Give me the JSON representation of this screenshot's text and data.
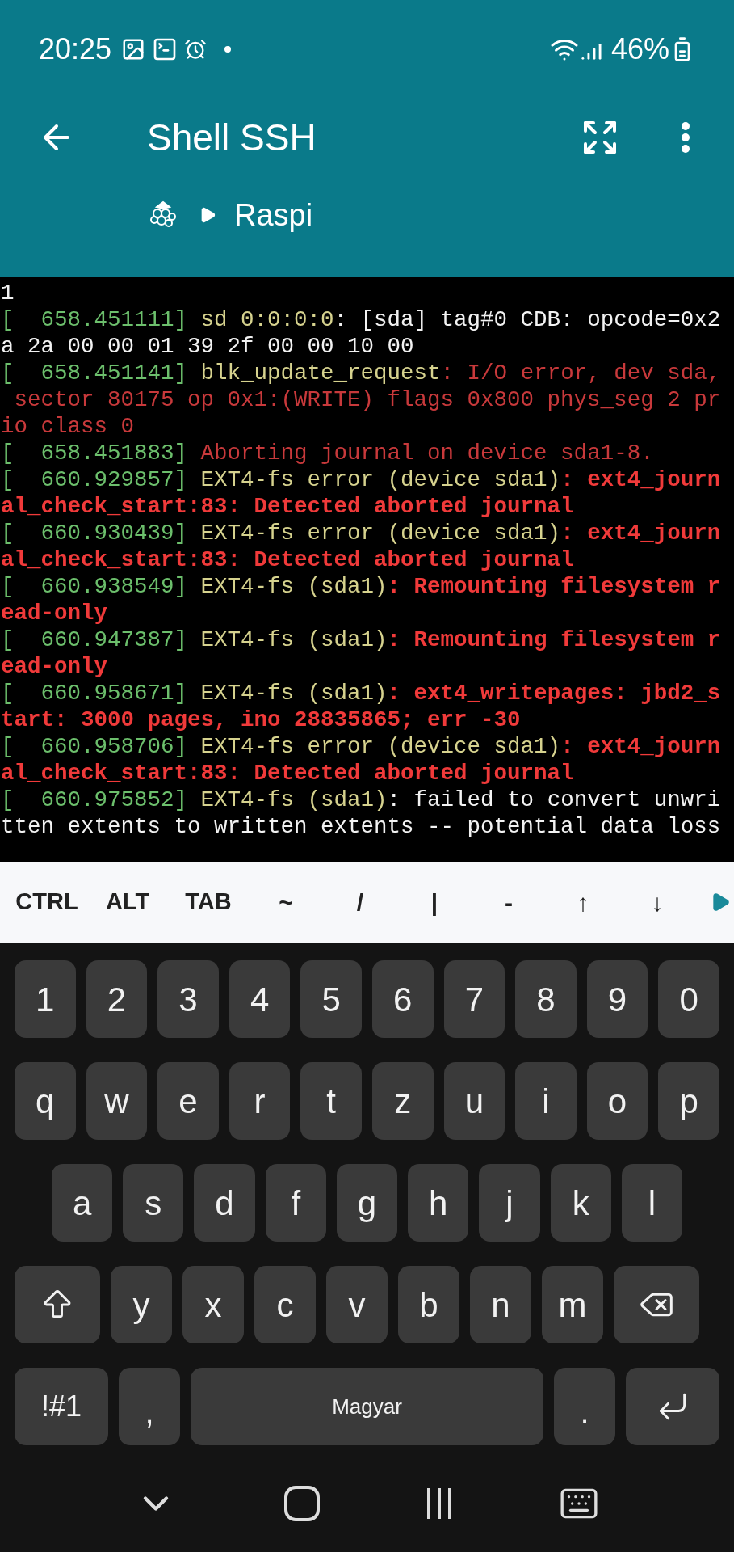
{
  "status_bar": {
    "time": "20:25",
    "battery": "46%"
  },
  "app_bar": {
    "title": "Shell SSH",
    "breadcrumb": "Raspi"
  },
  "terminal": {
    "lines": [
      {
        "segments": [
          {
            "text": "1",
            "color": "#f2f2f2",
            "bold": false
          }
        ]
      },
      {
        "segments": [
          {
            "text": "[  658.451111]",
            "color": "#6cbf6c",
            "bold": false
          },
          {
            "text": " sd 0:0:0:0",
            "color": "#d6d28e",
            "bold": false
          },
          {
            "text": ": [sda] tag#0 CDB: opcode=0x2",
            "color": "#f2f2f2",
            "bold": false
          }
        ]
      },
      {
        "segments": [
          {
            "text": "a 2a 00 00 01 39 2f 00 00 10 00",
            "color": "#f2f2f2",
            "bold": false
          }
        ]
      },
      {
        "segments": [
          {
            "text": "[  658.451141]",
            "color": "#6cbf6c",
            "bold": false
          },
          {
            "text": " blk_update_request",
            "color": "#d6d28e",
            "bold": false
          },
          {
            "text": ": I/O error, dev sda,",
            "color": "#c8393b",
            "bold": false
          }
        ]
      },
      {
        "segments": [
          {
            "text": " sector 80175 op 0x1:(WRITE) flags 0x800 phys_seg 2 pr",
            "color": "#c8393b",
            "bold": false
          }
        ]
      },
      {
        "segments": [
          {
            "text": "io class 0",
            "color": "#c8393b",
            "bold": false
          }
        ]
      },
      {
        "segments": [
          {
            "text": "[  658.451883]",
            "color": "#6cbf6c",
            "bold": false
          },
          {
            "text": " Aborting journal on device sda1-8.",
            "color": "#c8393b",
            "bold": false
          }
        ]
      },
      {
        "segments": [
          {
            "text": "[  660.929857]",
            "color": "#6cbf6c",
            "bold": false
          },
          {
            "text": " EXT4-fs error (device sda1)",
            "color": "#d6d28e",
            "bold": false
          },
          {
            "text": ": ext4_journ",
            "color": "#f03a3a",
            "bold": true
          }
        ]
      },
      {
        "segments": [
          {
            "text": "al_check_start:83: Detected aborted journal",
            "color": "#f03a3a",
            "bold": true
          }
        ]
      },
      {
        "segments": [
          {
            "text": "[  660.930439]",
            "color": "#6cbf6c",
            "bold": false
          },
          {
            "text": " EXT4-fs error (device sda1)",
            "color": "#d6d28e",
            "bold": false
          },
          {
            "text": ": ext4_journ",
            "color": "#f03a3a",
            "bold": true
          }
        ]
      },
      {
        "segments": [
          {
            "text": "al_check_start:83: Detected aborted journal",
            "color": "#f03a3a",
            "bold": true
          }
        ]
      },
      {
        "segments": [
          {
            "text": "[  660.938549]",
            "color": "#6cbf6c",
            "bold": false
          },
          {
            "text": " EXT4-fs (sda1)",
            "color": "#d6d28e",
            "bold": false
          },
          {
            "text": ": Remounting filesystem r",
            "color": "#f03a3a",
            "bold": true
          }
        ]
      },
      {
        "segments": [
          {
            "text": "ead-only",
            "color": "#f03a3a",
            "bold": true
          }
        ]
      },
      {
        "segments": [
          {
            "text": "[  660.947387]",
            "color": "#6cbf6c",
            "bold": false
          },
          {
            "text": " EXT4-fs (sda1)",
            "color": "#d6d28e",
            "bold": false
          },
          {
            "text": ": Remounting filesystem r",
            "color": "#f03a3a",
            "bold": true
          }
        ]
      },
      {
        "segments": [
          {
            "text": "ead-only",
            "color": "#f03a3a",
            "bold": true
          }
        ]
      },
      {
        "segments": [
          {
            "text": "[  660.958671]",
            "color": "#6cbf6c",
            "bold": false
          },
          {
            "text": " EXT4-fs (sda1)",
            "color": "#d6d28e",
            "bold": false
          },
          {
            "text": ": ext4_writepages: jbd2_s",
            "color": "#f03a3a",
            "bold": true
          }
        ]
      },
      {
        "segments": [
          {
            "text": "tart: 3000 pages, ino 28835865; err -30",
            "color": "#f03a3a",
            "bold": true
          }
        ]
      },
      {
        "segments": [
          {
            "text": "[  660.958706]",
            "color": "#6cbf6c",
            "bold": false
          },
          {
            "text": " EXT4-fs error (device sda1)",
            "color": "#d6d28e",
            "bold": false
          },
          {
            "text": ": ext4_journ",
            "color": "#f03a3a",
            "bold": true
          }
        ]
      },
      {
        "segments": [
          {
            "text": "al_check_start:83: Detected aborted journal",
            "color": "#f03a3a",
            "bold": true
          }
        ]
      },
      {
        "segments": [
          {
            "text": "[  660.975852]",
            "color": "#6cbf6c",
            "bold": false
          },
          {
            "text": " EXT4-fs (sda1)",
            "color": "#d6d28e",
            "bold": false
          },
          {
            "text": ": failed to convert unwri",
            "color": "#f2f2f2",
            "bold": false
          }
        ]
      },
      {
        "segments": [
          {
            "text": "tten extents to written extents -- potential data loss",
            "color": "#f2f2f2",
            "bold": false
          }
        ]
      }
    ]
  },
  "extra_keys": [
    {
      "label": "CTRL",
      "kind": "word"
    },
    {
      "label": "ALT",
      "kind": "word"
    },
    {
      "label": "TAB",
      "kind": "word"
    },
    {
      "label": "~",
      "kind": "symbol"
    },
    {
      "label": "/",
      "kind": "symbol"
    },
    {
      "label": "|",
      "kind": "symbol"
    },
    {
      "label": "-",
      "kind": "symbol"
    },
    {
      "label": "↑",
      "kind": "symbol"
    },
    {
      "label": "↓",
      "kind": "symbol"
    }
  ],
  "keyboard": {
    "rows": [
      [
        {
          "label": "1",
          "kind": "char"
        },
        {
          "label": "2",
          "kind": "char"
        },
        {
          "label": "3",
          "kind": "char"
        },
        {
          "label": "4",
          "kind": "char"
        },
        {
          "label": "5",
          "kind": "char"
        },
        {
          "label": "6",
          "kind": "char"
        },
        {
          "label": "7",
          "kind": "char"
        },
        {
          "label": "8",
          "kind": "char"
        },
        {
          "label": "9",
          "kind": "char"
        },
        {
          "label": "0",
          "kind": "char"
        }
      ],
      [
        {
          "label": "q",
          "kind": "char"
        },
        {
          "label": "w",
          "kind": "char"
        },
        {
          "label": "e",
          "kind": "char"
        },
        {
          "label": "r",
          "kind": "char"
        },
        {
          "label": "t",
          "kind": "char"
        },
        {
          "label": "z",
          "kind": "char"
        },
        {
          "label": "u",
          "kind": "char"
        },
        {
          "label": "i",
          "kind": "char"
        },
        {
          "label": "o",
          "kind": "char"
        },
        {
          "label": "p",
          "kind": "char"
        }
      ],
      [
        {
          "label": "a",
          "kind": "char"
        },
        {
          "label": "s",
          "kind": "char"
        },
        {
          "label": "d",
          "kind": "char"
        },
        {
          "label": "f",
          "kind": "char"
        },
        {
          "label": "g",
          "kind": "char"
        },
        {
          "label": "h",
          "kind": "char"
        },
        {
          "label": "j",
          "kind": "char"
        },
        {
          "label": "k",
          "kind": "char"
        },
        {
          "label": "l",
          "kind": "char"
        }
      ],
      [
        {
          "kind": "shift"
        },
        {
          "label": "y",
          "kind": "char"
        },
        {
          "label": "x",
          "kind": "char"
        },
        {
          "label": "c",
          "kind": "char"
        },
        {
          "label": "v",
          "kind": "char"
        },
        {
          "label": "b",
          "kind": "char"
        },
        {
          "label": "n",
          "kind": "char"
        },
        {
          "label": "m",
          "kind": "char"
        },
        {
          "kind": "backspace"
        }
      ],
      [
        {
          "label": "!#1",
          "kind": "mode"
        },
        {
          "label": ",",
          "kind": "punct"
        },
        {
          "label": "Magyar",
          "kind": "space"
        },
        {
          "label": ".",
          "kind": "punct"
        },
        {
          "kind": "enter"
        }
      ]
    ]
  }
}
